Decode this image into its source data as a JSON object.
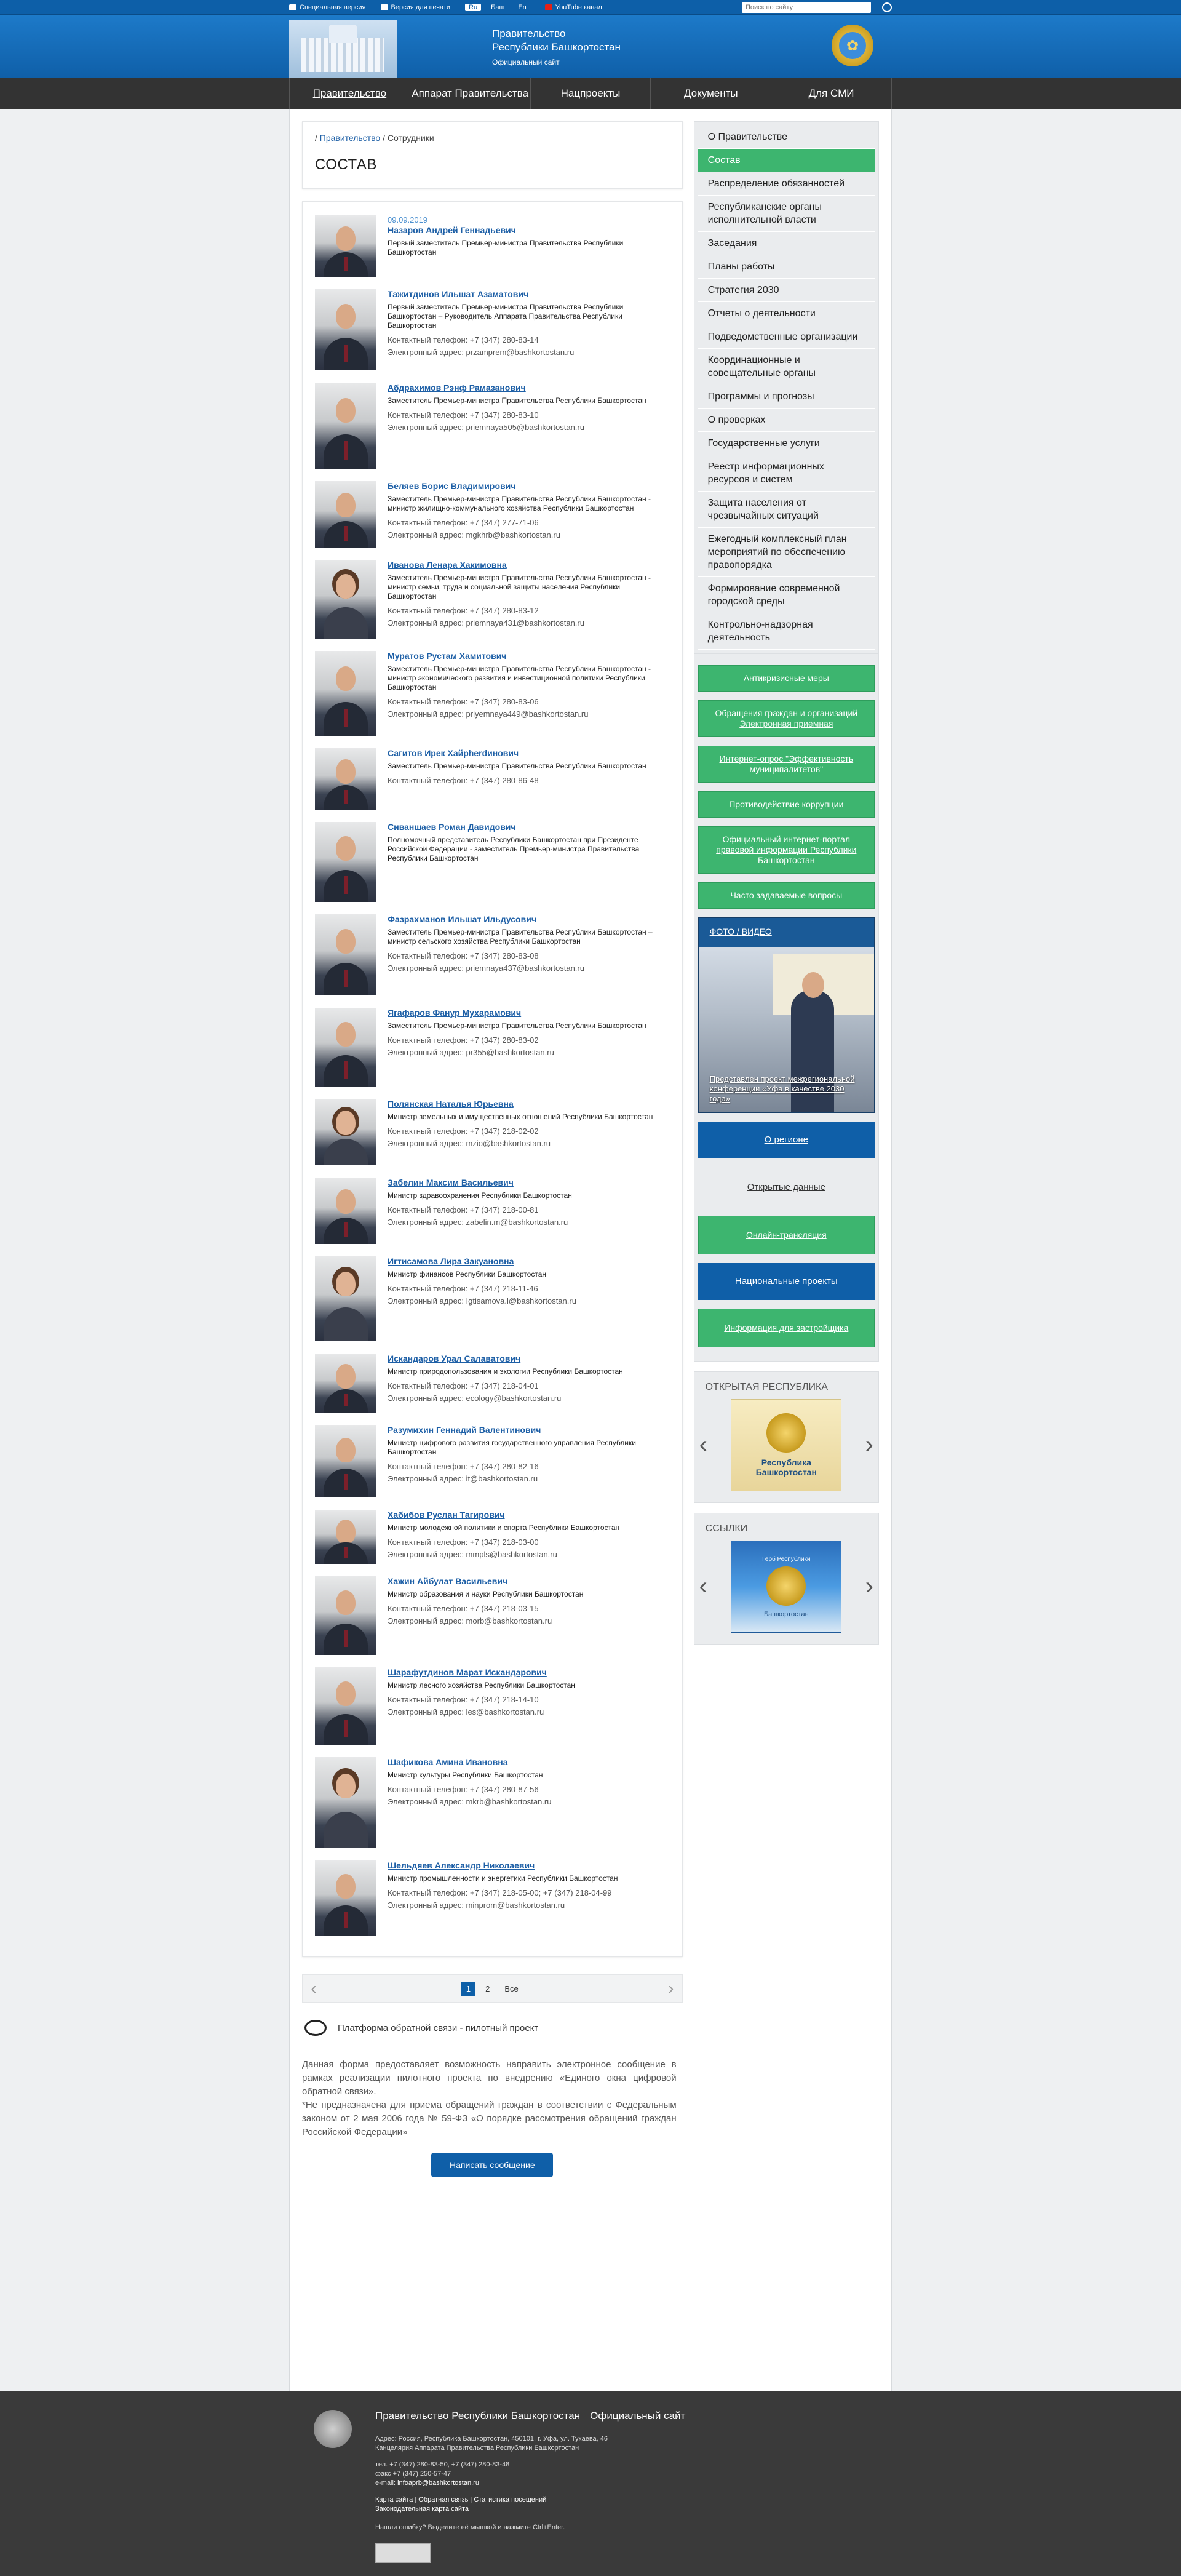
{
  "topbar": {
    "special_version": "Специальная версия",
    "print_version": "Версия для печати",
    "languages": [
      "Ru",
      "Баш",
      "En"
    ],
    "youtube": "YouTube канал",
    "search_placeholder": "Поиск по сайту"
  },
  "header": {
    "title_line1": "Правительство",
    "title_line2": "Республики Башкортостан",
    "subtitle": "Официальный сайт"
  },
  "nav": [
    "Правительство",
    "Аппарат Правительства",
    "Нацпроекты",
    "Документы",
    "Для СМИ"
  ],
  "breadcrumb": {
    "link": "Правительство",
    "current": "Сотрудники"
  },
  "page_title": "СОСТАВ",
  "date": "09.09.2019",
  "people": [
    {
      "name": "Назаров Андрей Геннадьевич",
      "position": "Первый заместитель Премьер-министра Правительства Республики Башкортостан",
      "phone": "",
      "email": ""
    },
    {
      "name": "Тажитдинов Ильшат Азаматович",
      "position": "Первый заместитель Премьер-министра Правительства Республики Башкортостан – Руководитель Аппарата Правительства Республики Башкортостан",
      "phone": "Контактный телефон: +7 (347) 280-83-14",
      "email": "Электронный адрес: przamprem@bashkortostan.ru"
    },
    {
      "name": "Абдрахимов Рэнф Рамазанович",
      "position": "Заместитель Премьер-министра Правительства Республики Башкортостан",
      "phone": "Контактный телефон: +7 (347) 280-83-10",
      "email": "Электронный адрес: priemnaya505@bashkortostan.ru"
    },
    {
      "name": "Беляев Борис Владимирович",
      "position": "Заместитель Премьер-министра Правительства Республики Башкортостан - министр жилищно-коммунального хозяйства Республики Башкортостан",
      "phone": "Контактный телефон: +7 (347) 277-71-06",
      "email": "Электронный адрес: mgkhrb@bashkortostan.ru"
    },
    {
      "name": "Иванова Ленара Хакимовна",
      "position": "Заместитель Премьер-министра Правительства Республики Башкортостан - министр семьи, труда и социальной защиты населения Республики Башкортостан",
      "phone": "Контактный телефон: +7 (347) 280-83-12",
      "email": "Электронный адрес: priemnaya431@bashkortostan.ru"
    },
    {
      "name": "Муратов Рустам Хамитович",
      "position": "Заместитель Премьер-министра Правительства Республики Башкортостан - министр экономического развития и инвестиционной политики Республики Башкортостан",
      "phone": "Контактный телефон: +7 (347) 280-83-06",
      "email": "Электронный адрес: priyemnaya449@bashkortostan.ru"
    },
    {
      "name": "Сагитов Ирек Хайрherdинович",
      "position": "Заместитель Премьер-министра Правительства Республики Башкортостан",
      "phone": "Контактный телефон: +7 (347) 280-86-48",
      "email": ""
    },
    {
      "name": "Сиваншаев Роман Давидович",
      "position": "Полномочный представитель Республики Башкортостан при Президенте Российской Федерации - заместитель Премьер-министра Правительства Республики Башкортостан",
      "phone": "",
      "email": ""
    },
    {
      "name": "Фазрахманов Ильшат Ильдусович",
      "position": "Заместитель Премьер-министра Правительства Республики Башкортостан – министр сельского хозяйства Республики Башкортостан",
      "phone": "Контактный телефон: +7 (347) 280-83-08",
      "email": "Электронный адрес: priemnaya437@bashkortostan.ru"
    },
    {
      "name": "Ягафаров Фанур Мухарамович",
      "position": "Заместитель Премьер-министра Правительства Республики Башкортостан",
      "phone": "Контактный телефон: +7 (347) 280-83-02",
      "email": "Электронный адрес: pr355@bashkortostan.ru"
    },
    {
      "name": "Полянская Наталья Юрьевна",
      "position": "Министр земельных и имущественных отношений Республики Башкортостан",
      "phone": "Контактный телефон: +7 (347) 218-02-02",
      "email": "Электронный адрес: mzio@bashkortostan.ru"
    },
    {
      "name": "Забелин Максим Васильевич",
      "position": "Министр здравоохранения Республики Башкортостан",
      "phone": "Контактный телефон: +7 (347) 218-00-81",
      "email": "Электронный адрес: zabelin.m@bashkortostan.ru"
    },
    {
      "name": "Игтисамова Лира Закуановна",
      "position": "Министр финансов Республики Башкортостан",
      "phone": "Контактный телефон: +7 (347) 218-11-46",
      "email": "Электронный адрес: Igtisamova.l@bashkortostan.ru"
    },
    {
      "name": "Искандаров Урал Салаватович",
      "position": "Министр природопользования и экологии Республики Башкортостан",
      "phone": "Контактный телефон: +7 (347) 218-04-01",
      "email": "Электронный адрес: ecology@bashkortostan.ru"
    },
    {
      "name": "Разумихин Геннадий Валентинович",
      "position": "Министр цифрового развития государственного управления Республики Башкортостан",
      "phone": "Контактный телефон: +7 (347) 280-82-16",
      "email": "Электронный адрес: it@bashkortostan.ru"
    },
    {
      "name": "Хабибов Руслан Тагирович",
      "position": "Министр молодежной политики и спорта Республики Башкортостан",
      "phone": "Контактный телефон: +7 (347) 218-03-00",
      "email": "Электронный адрес: mmpls@bashkortostan.ru"
    },
    {
      "name": "Хажин Айбулат Васильевич",
      "position": "Министр образования и науки Республики Башкортостан",
      "phone": "Контактный телефон: +7 (347) 218-03-15",
      "email": "Электронный адрес: morb@bashkortostan.ru"
    },
    {
      "name": "Шарафутдинов Марат Искандарович",
      "position": "Министр лесного хозяйства Республики Башкортостан",
      "phone": "Контактный телефон: +7 (347) 218-14-10",
      "email": "Электронный адрес: les@bashkortostan.ru"
    },
    {
      "name": "Шафикова Амина Ивановна",
      "position": "Министр культуры Республики Башкортостан",
      "phone": "Контактный телефон: +7 (347) 280-87-56",
      "email": "Электронный адрес: mkrb@bashkortostan.ru"
    },
    {
      "name": "Шельдяев Александр Николаевич",
      "position": "Министр промышленности и энергетики Республики Башкортостан",
      "phone": "Контактный телефон: +7 (347) 218-05-00; +7 (347) 218-04-99",
      "email": "Электронный адрес: minprom@bashkortostan.ru"
    }
  ],
  "pager": {
    "pages": [
      "1",
      "2"
    ],
    "all": "Все"
  },
  "feedback": {
    "title": "Платформа обратной связи - пилотный проект",
    "text1": "Данная форма предоставляет возможность направить электронное сообщение в рамках реализации пилотного проекта по внедрению «Единого окна цифровой обратной связи».",
    "text2": "*Не предназначена для приема обращений граждан в соответствии с Федеральным законом от 2 мая 2006 года № 59-ФЗ «О порядке рассмотрения обращений граждан Российской Федерации»",
    "button": "Написать сообщение"
  },
  "side_menu": [
    "О Правительстве",
    "Состав",
    "Распределение обязанностей",
    "Республиканские органы исполнительной власти",
    "Заседания",
    "Планы работы",
    "Стратегия 2030",
    "Отчеты о деятельности",
    "Подведомственные организации",
    "Координационные и совещательные органы",
    "Программы и прогнозы",
    "О проверках",
    "Государственные услуги",
    "Реестр информационных ресурсов и систем",
    "Защита населения от чрезвычайных ситуаций",
    "Ежегодный комплексный план мероприятий по обеспечению правопорядка",
    "Формирование современной городской среды",
    "Контрольно-надзорная деятельность"
  ],
  "side_buttons": {
    "anticrisis": "Антикризисные меры",
    "appeals": "Обращения граждан и организаций",
    "appeals_sub": "Электронная приемная",
    "survey_link": "Интернет-опрос",
    "survey_text": "\"Эффективность муниципалитетов\"",
    "corruption": "Противодействие коррупции",
    "legal_portal": "Официальный интернет-портал правовой информации Республики Башкортостан",
    "faq": "Часто задаваемые вопросы"
  },
  "media": {
    "photo": "ФОТО",
    "video": "ВИДЕО",
    "caption": "Представлен проект межрегиональной конференции «Уфа в качестве 2030 года»"
  },
  "links": {
    "region": "О регионе",
    "open_data": "Открытые данные",
    "online": "Онлайн-трансляция",
    "national_projects": "Национальные проекты",
    "developer_info": "Информация для застройщика"
  },
  "open_republic": {
    "title": "ОТКРЫТАЯ РЕСПУБЛИКА",
    "logo_text": "Республика Башкортостан"
  },
  "side_links": {
    "title": "ССЫЛКИ",
    "top": "Герб Республики",
    "bottom": "Башкортостан"
  },
  "footer": {
    "title": "Правительство Республики Башкортостан",
    "subtitle": "Официальный сайт",
    "address": "Адрес: Россия, Республика Башкортостан, 450101, г. Уфа, ул. Тукаева, 46",
    "office": "Канцелярия Аппарата Правительства Республики Башкортостан",
    "phone": "тел. +7 (347) 280-83-50, +7 (347) 280-83-48",
    "fax": "факс +7 (347) 250-57-47",
    "email_label": "e-mail:",
    "email": "infoaprb@bashkortostan.ru",
    "sitemap": "Карта сайта",
    "feedback": "Обратная связь",
    "stats": "Статистика посещений",
    "old_map": "Законодательная карта сайта",
    "error_line1": "Нашли ошибку? Выделите её мышкой и нажмите Ctrl+Enter."
  }
}
